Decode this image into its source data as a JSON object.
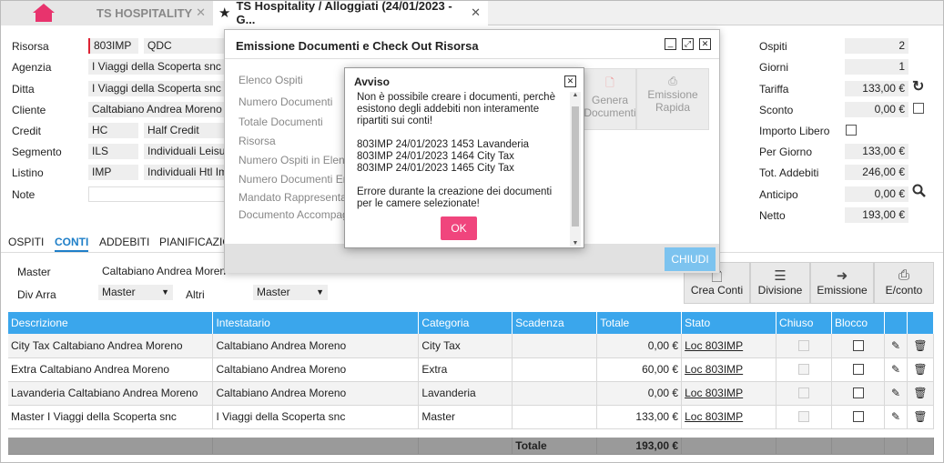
{
  "tabs": {
    "home_icon": "home-icon",
    "tab1": "TS HOSPITALITY",
    "tab2": "TS Hospitality / Alloggiati (24/01/2023 - G...",
    "close": "✕"
  },
  "form": {
    "risorsa_label": "Risorsa",
    "risorsa_code": "803IMP",
    "risorsa_type": "QDC",
    "agenzia_label": "Agenzia",
    "agenzia_value": "I Viaggi della Scoperta snc",
    "ditta_label": "Ditta",
    "ditta_value": "I Viaggi della Scoperta snc",
    "cliente_label": "Cliente",
    "cliente_value": "Caltabiano Andrea Moreno",
    "credit_label": "Credit",
    "credit_code": "HC",
    "credit_desc": "Half Credit",
    "segmento_label": "Segmento",
    "segmento_code": "ILS",
    "segmento_desc": "Individuali Leisur",
    "listino_label": "Listino",
    "listino_code": "IMP",
    "listino_desc": "Individuali Htl Im",
    "note_label": "Note"
  },
  "summary": {
    "ospiti_label": "Ospiti",
    "ospiti": "2",
    "giorni_label": "Giorni",
    "giorni": "1",
    "tariffa_label": "Tariffa",
    "tariffa": "133,00 €",
    "sconto_label": "Sconto",
    "sconto": "0,00 €",
    "importo_label": "Importo Libero",
    "pergiorno_label": "Per Giorno",
    "pergiorno": "133,00 €",
    "totadd_label": "Tot. Addebiti",
    "totadd": "246,00 €",
    "anticipo_label": "Anticipo",
    "anticipo": "0,00 €",
    "netto_label": "Netto",
    "netto": "193,00 €"
  },
  "subtabs": [
    "OSPITI",
    "CONTI",
    "ADDEBITI",
    "PIANIFICAZIO"
  ],
  "conti": {
    "master_label": "Master",
    "master_value": "Caltabiano Andrea Moreno",
    "divarra_label": "Div Arra",
    "divarra_value": "Master",
    "altri_label": "Altri",
    "altri_value": "Master"
  },
  "buttons": {
    "crea": "Crea Conti",
    "divisione": "Divisione",
    "emissione": "Emissione",
    "econto": "E/conto"
  },
  "table": {
    "headers": [
      "Descrizione",
      "Intestatario",
      "Categoria",
      "Scadenza",
      "Totale",
      "Stato",
      "Chiuso",
      "Blocco"
    ],
    "rows": [
      {
        "desc": "City Tax Caltabiano Andrea Moreno",
        "int": "Caltabiano Andrea Moreno",
        "cat": "City Tax",
        "tot": "0,00 €",
        "stato": "Loc 803IMP"
      },
      {
        "desc": "Extra Caltabiano Andrea Moreno",
        "int": "Caltabiano Andrea Moreno",
        "cat": "Extra",
        "tot": "60,00 €",
        "stato": "Loc 803IMP"
      },
      {
        "desc": "Lavanderia Caltabiano Andrea Moreno",
        "int": "Caltabiano Andrea Moreno",
        "cat": "Lavanderia",
        "tot": "0,00 €",
        "stato": "Loc 803IMP"
      },
      {
        "desc": "Master I Viaggi della Scoperta snc",
        "int": "I Viaggi della Scoperta snc",
        "cat": "Master",
        "tot": "133,00 €",
        "stato": "Loc 803IMP"
      }
    ],
    "total_label": "Totale",
    "total_value": "193,00 €"
  },
  "dialog": {
    "title": "Emissione Documenti e Check Out Risorsa",
    "labels": [
      "Elenco Ospiti",
      "Numero Documenti",
      "Totale Documenti",
      "Risorsa",
      "Numero Ospiti in Elenco",
      "Numero Documenti Emessi",
      "Mandato Rappresentante",
      "Documento Accompagnatorio"
    ],
    "genera": "Genera Documenti",
    "emissione_rapida": "Emissione Rapida",
    "chiudi": "CHIUDI"
  },
  "alert": {
    "title": "Avviso",
    "msg1": "Non è possibile creare i documenti, perchè esistono degli addebiti non interamente ripartiti sui conti!",
    "line1": "803IMP 24/01/2023 1453 Lavanderia",
    "line2": "803IMP 24/01/2023 1464 City Tax",
    "line3": "803IMP 24/01/2023 1465 City Tax",
    "msg2": "Errore durante la creazione dei documenti per le camere selezionate!",
    "ok": "OK"
  },
  "colors": {
    "accent": "#3aa6ec",
    "home": "#e8336d",
    "ok": "#f0457d",
    "chiudi": "#7cc3ef"
  }
}
